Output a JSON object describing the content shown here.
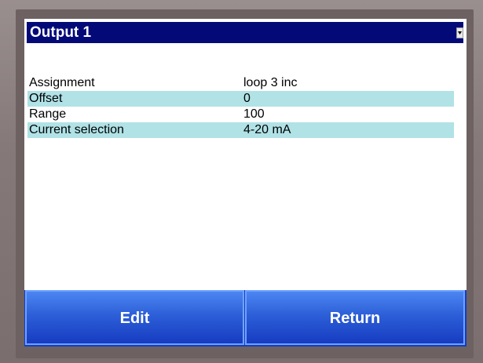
{
  "header": {
    "title": "Output 1"
  },
  "parameters": [
    {
      "name": "Assignment",
      "value": "loop 3 inc"
    },
    {
      "name": "Offset",
      "value": "0"
    },
    {
      "name": "Range",
      "value": "100"
    },
    {
      "name": "Current selection",
      "value": "4-20 mA"
    }
  ],
  "buttons": {
    "edit_label": "Edit",
    "return_label": "Return"
  },
  "icons": {
    "dropdown": "chevron-down-icon"
  },
  "colors": {
    "title_bar": "#030a78",
    "row_highlight": "#b0e2e6",
    "button_blue": "#2d5fd8",
    "bezel": "#7f7272"
  }
}
